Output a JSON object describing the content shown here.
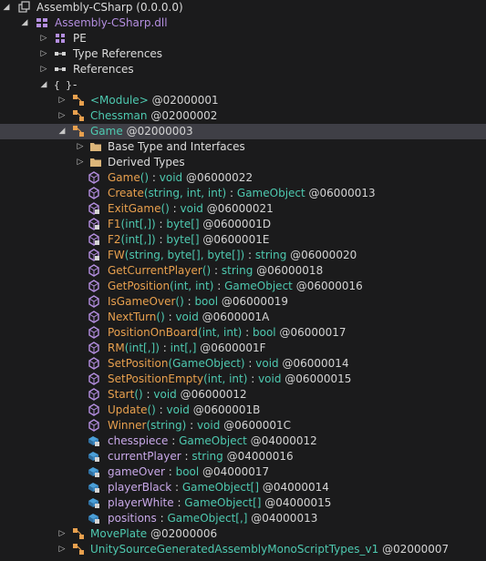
{
  "tree": {
    "assembly": {
      "name": "Assembly-CSharp",
      "version": "(0.0.0.0)"
    },
    "module": {
      "name": "Assembly-CSharp.dll"
    },
    "pe": "PE",
    "type_refs": "Type References",
    "references": "References",
    "namespace": "-",
    "types": [
      {
        "name": "<Module>",
        "token": "@02000001"
      },
      {
        "name": "Chessman",
        "token": "@02000002"
      },
      {
        "name": "Game",
        "token": "@02000003"
      }
    ],
    "game_children": {
      "base": "Base Type and Interfaces",
      "derived": "Derived Types"
    },
    "methods": [
      {
        "name": "Game",
        "params": "()",
        "sep": " : ",
        "ret": "void",
        "token": " @06000022"
      },
      {
        "name": "Create",
        "params": "(string, int, int)",
        "sep": " : ",
        "ret": "GameObject",
        "token": " @06000013"
      },
      {
        "name": "ExitGame",
        "params": "()",
        "sep": " : ",
        "ret": "void",
        "token": " @06000021"
      },
      {
        "name": "F1",
        "params": "(int[,])",
        "sep": " : ",
        "ret": "byte[]",
        "token": " @0600001D"
      },
      {
        "name": "F2",
        "params": "(int[,])",
        "sep": " : ",
        "ret": "byte[]",
        "token": " @0600001E"
      },
      {
        "name": "FW",
        "params": "(string, byte[], byte[])",
        "sep": " : ",
        "ret": "string",
        "token": " @06000020"
      },
      {
        "name": "GetCurrentPlayer",
        "params": "()",
        "sep": " : ",
        "ret": "string",
        "token": " @06000018"
      },
      {
        "name": "GetPosition",
        "params": "(int, int)",
        "sep": " : ",
        "ret": "GameObject",
        "token": " @06000016"
      },
      {
        "name": "IsGameOver",
        "params": "()",
        "sep": " : ",
        "ret": "bool",
        "token": " @06000019"
      },
      {
        "name": "NextTurn",
        "params": "()",
        "sep": " : ",
        "ret": "void",
        "token": " @0600001A"
      },
      {
        "name": "PositionOnBoard",
        "params": "(int, int)",
        "sep": " : ",
        "ret": "bool",
        "token": " @06000017"
      },
      {
        "name": "RM",
        "params": "(int[,])",
        "sep": " : ",
        "ret": "int[,]",
        "token": " @0600001F"
      },
      {
        "name": "SetPosition",
        "params": "(GameObject)",
        "sep": " : ",
        "ret": "void",
        "token": " @06000014"
      },
      {
        "name": "SetPositionEmpty",
        "params": "(int, int)",
        "sep": " : ",
        "ret": "void",
        "token": " @06000015"
      },
      {
        "name": "Start",
        "params": "()",
        "sep": " : ",
        "ret": "void",
        "token": " @06000012"
      },
      {
        "name": "Update",
        "params": "()",
        "sep": " : ",
        "ret": "void",
        "token": " @0600001B"
      },
      {
        "name": "Winner",
        "params": "(string)",
        "sep": " : ",
        "ret": "void",
        "token": " @0600001C"
      }
    ],
    "fields": [
      {
        "name": "chesspiece",
        "sep": " : ",
        "type": "GameObject",
        "token": " @04000012"
      },
      {
        "name": "currentPlayer",
        "sep": " : ",
        "type": "string",
        "token": " @04000016"
      },
      {
        "name": "gameOver",
        "sep": " : ",
        "type": "bool",
        "token": " @04000017"
      },
      {
        "name": "playerBlack",
        "sep": " : ",
        "type": "GameObject[]",
        "token": " @04000014"
      },
      {
        "name": "playerWhite",
        "sep": " : ",
        "type": "GameObject[]",
        "token": " @04000015"
      },
      {
        "name": "positions",
        "sep": " : ",
        "type": "GameObject[,]",
        "token": " @04000013"
      }
    ],
    "more_types": [
      {
        "name": "MovePlate",
        "token": "@02000006"
      },
      {
        "name": "UnitySourceGeneratedAssemblyMonoScriptTypes_v1",
        "token": "@02000007"
      }
    ]
  },
  "colors": {
    "background": "#1b1b1c",
    "selection": "#3f3f46",
    "type_name": "#4ec9b0",
    "method_name": "#e8a04e",
    "assembly_name": "#b48ee0"
  }
}
